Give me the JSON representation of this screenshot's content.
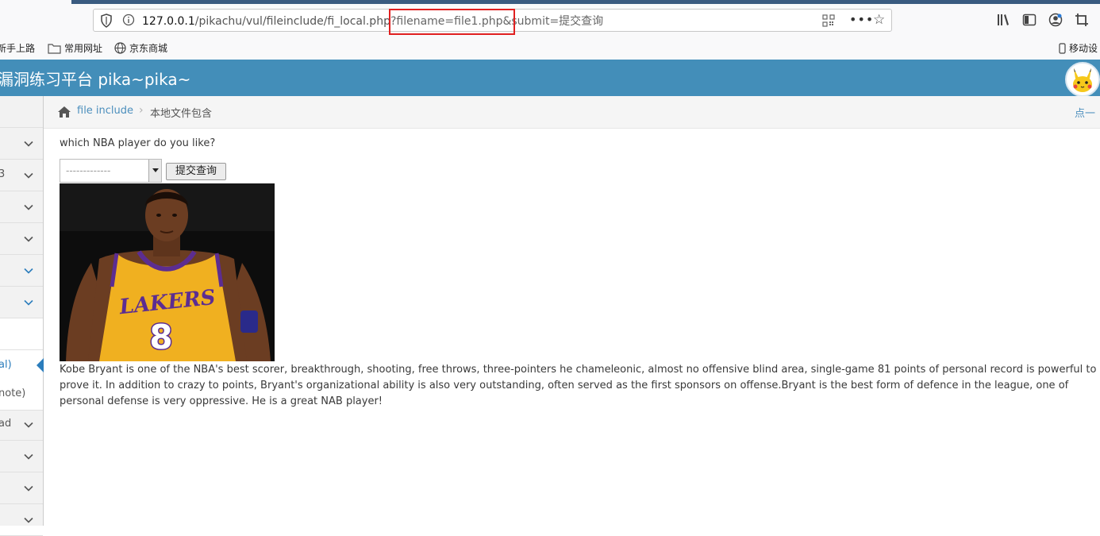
{
  "browser": {
    "url_host": "127.0.0.1",
    "url_path": "/pikachu/vul/fileinclude/fi_local.php",
    "url_query": "?filename=file1.php&submit=提交查询",
    "icons": [
      "shield-icon",
      "info-icon",
      "qr-code-icon",
      "more-icon",
      "bookmark-star-icon",
      "library-icon",
      "sidebar-icon",
      "account-icon",
      "screenshot-icon"
    ]
  },
  "bookmarks": {
    "item1": "新手上路",
    "item2": "常用网址",
    "item3": "京东商城",
    "mobile": "移动设"
  },
  "header": {
    "title": "漏洞练习平台 pika~pika~"
  },
  "sidebar": {
    "items": [
      {
        "label": ""
      },
      {
        "label": "3"
      },
      {
        "label": ""
      },
      {
        "label": ""
      },
      {
        "label": ""
      },
      {
        "label": ""
      },
      {
        "label": ""
      },
      {
        "label": "al)"
      },
      {
        "label": "note)"
      },
      {
        "label": "ad"
      },
      {
        "label": ""
      },
      {
        "label": ""
      },
      {
        "label": ""
      }
    ]
  },
  "breadcrumb": {
    "item1": "file include",
    "separator": "›",
    "item2": "本地文件包含",
    "hint": "点一"
  },
  "main": {
    "question": "which NBA player do you like?",
    "select_value": "-------------",
    "submit_label": "提交查询",
    "description": "Kobe Bryant is one of the NBA's best scorer, breakthrough, shooting, free throws, three-pointers he chameleonic, almost no offensive blind area, single-game 81 points of personal record is powerful to prove it. In addition to crazy to points, Bryant's organizational ability is also very outstanding, often served as the first sponsors on offense.Bryant is the best form of defence in the league, one of personal defense is very oppressive. He is a great NAB player!",
    "jersey_text": "LAKERS",
    "jersey_number": "8"
  },
  "colors": {
    "header": "#438eb9",
    "link": "#4c8fbd",
    "highlight": "#e02020",
    "jersey": "#f0b020"
  }
}
